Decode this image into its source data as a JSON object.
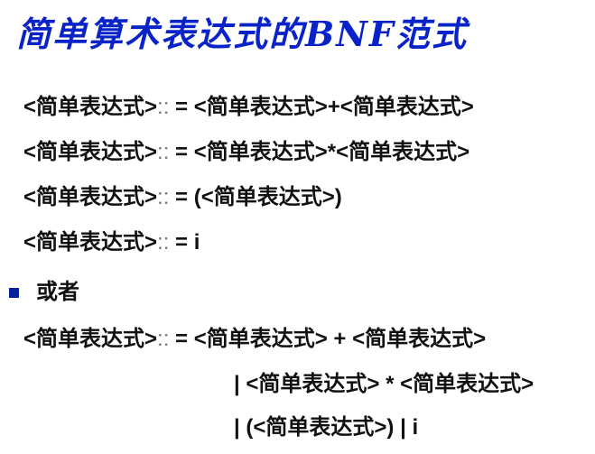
{
  "slide": {
    "title": "简单算术表达式的BNF范式",
    "rules": [
      {
        "lhs": "<简单表达式>",
        "op": "::",
        "rhs": " = <简单表达式>+<简单表达式>"
      },
      {
        "lhs": "<简单表达式>",
        "op": "::",
        "rhs": " = <简单表达式>*<简单表达式>"
      },
      {
        "lhs": "<简单表达式>",
        "op": "::",
        "rhs": " = (<简单表达式>)"
      },
      {
        "lhs": "<简单表达式>",
        "op": "::",
        "rhs": " = i"
      }
    ],
    "bullet": {
      "text": "或者",
      "icon": "square-bullet-icon"
    },
    "combined_rule": {
      "lhs": "<简单表达式>",
      "op": "::",
      "rhs": " = <简单表达式> + <简单表达式>",
      "alt1": "| <简单表达式> * <简单表达式>",
      "alt2": "| (<简单表达式>) | i"
    },
    "colors": {
      "title": "#0a23c8",
      "text": "#111111",
      "bullet": "#0b1e9e",
      "colons": "#777777"
    }
  }
}
